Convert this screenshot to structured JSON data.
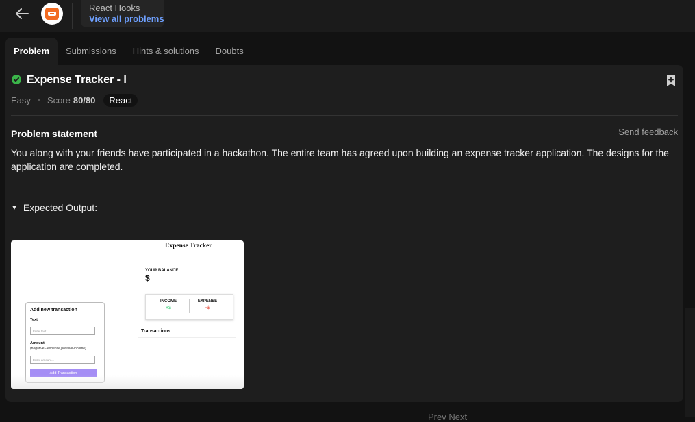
{
  "header": {
    "back_icon": "arrow-left-icon",
    "logo_icon": "coding-ninjas-logo",
    "course_title": "React Hooks",
    "course_link": "View all problems"
  },
  "tabs": [
    {
      "label": "Problem",
      "active": true
    },
    {
      "label": "Submissions",
      "active": false
    },
    {
      "label": "Hints & solutions",
      "active": false
    },
    {
      "label": "Doubts",
      "active": false
    }
  ],
  "problem": {
    "status_icon": "check-circle-icon",
    "title": "Expense Tracker - I",
    "difficulty": "Easy",
    "score_label": "Score",
    "score_value": "80/80",
    "tag": "React",
    "bookmark_icon": "bookmark-add-icon",
    "statement_title": "Problem statement",
    "feedback_label": "Send feedback",
    "statement_text": "You along with your friends have participated in a hackathon. The entire team has agreed upon building an expense tracker application. The designs for the application are completed.",
    "expected_label": "Expected Output:"
  },
  "preview": {
    "app_title": "Expense Tracker",
    "balance_label": "YOUR BALANCE",
    "balance_value": "$",
    "income_label": "INCOME",
    "income_value": "+$",
    "expense_label": "EXPENSE",
    "expense_value": "-$",
    "transactions_label": "Transactions",
    "form_title": "Add new transaction",
    "text_label": "Text",
    "text_placeholder": "Enter text",
    "amount_label": "Amount",
    "amount_hint": "(negative - expense,positive-income)",
    "amount_placeholder": "Enter amount...",
    "add_button": "Add Transaction",
    "colors": {
      "income": "#2ecc71",
      "expense": "#e74c3c",
      "button": "#a58ef5"
    }
  },
  "footer": {
    "nav_hint": "Prev          Next"
  },
  "colors": {
    "accent_link": "#6ea0ff",
    "check": "#3bb54a",
    "logo": "#f26b21"
  }
}
